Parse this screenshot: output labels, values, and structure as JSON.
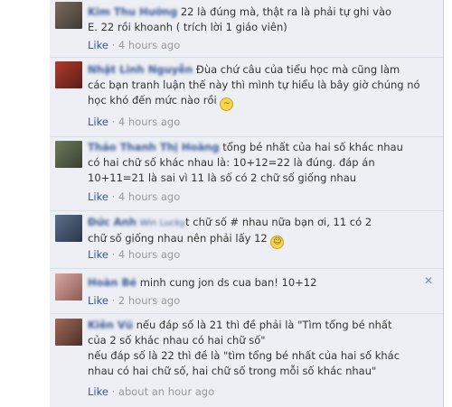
{
  "comments": [
    {
      "author": "Kim Thu Hường",
      "text": "22 là đúng mà, thật ra là phải tự ghi vào\nE. 22 rồi khoanh ( trích lời 1 giáo viên)",
      "like": "Like",
      "time": "4 hours ago"
    },
    {
      "author": "Nhật Linh Nguyễn",
      "text": "Đùa chứ câu của tiểu học mà cũng làm\ncác bạn tranh luận thế này thì mình tự hiểu là bây giờ chúng nó\nhọc khó đến mức nào rồi",
      "emoji": "confused-emoji",
      "like": "Like",
      "time": "4 hours ago"
    },
    {
      "author": "Thảo Thanh Thị Hoàng",
      "text": "tổng bé nhất của hai số khác nhau\ncó hai chữ số khác nhau là: 10+12=22 là đúng. đáp án\n10+11=21 là sai vì 11 là số có 2 chữ số giống nhau",
      "like": "Like",
      "time": "4 hours ago"
    },
    {
      "author": "Đức Anh",
      "author_extra": "Win Lucky",
      "text": "t chữ số # nhau nữa bạn ơi, 11 có 2\nchữ số giống nhau nên phải lấy 12",
      "emoji": "smile-emoji",
      "like": "Like",
      "time": "4 hours ago"
    },
    {
      "author": "Hoàn Bé",
      "text": "minh cung jon ds cua ban! 10+12",
      "like": "Like",
      "time": "2 hours ago",
      "close": "✕"
    },
    {
      "author": "Kiên Vũ",
      "text": "nếu đáp số là 21 thì đề phải là \"Tìm tổng bé nhất\ncủa 2 số khác nhau có hai chữ số\"\nnếu đáp số là 22 thì đề là \"tìm tổng bé nhất của hai số khác\nnhau có hai chữ số, hai chữ số trong mỗi số khác nhau\"",
      "like": "Like",
      "time": "about an hour ago"
    }
  ],
  "colors": {
    "link": "#3b5998",
    "meta": "#999999",
    "thread_bg": "#edeff4"
  }
}
